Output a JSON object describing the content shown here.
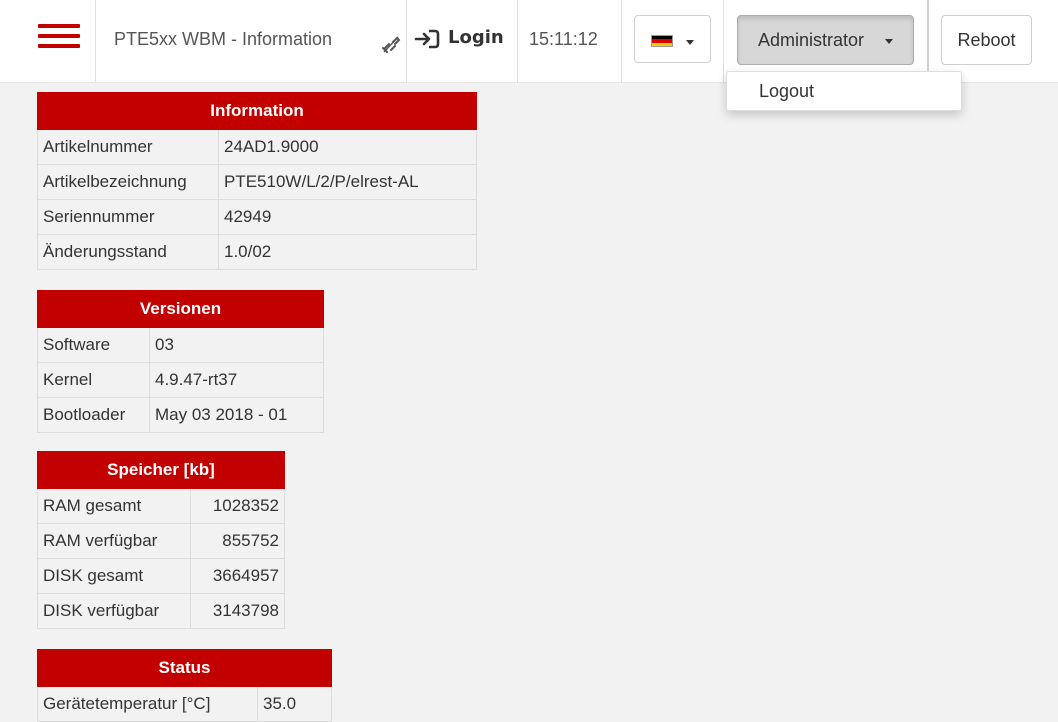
{
  "header": {
    "brand": "PTE5xx WBM - Information",
    "login_label": "Login",
    "time": "15:11:12",
    "user_button": "Administrator",
    "reboot_label": "Reboot",
    "dropdown": {
      "logout_label": "Logout"
    },
    "colors": {
      "accent": "#c30000"
    },
    "icons": {
      "menu": "hamburger-icon",
      "link": "unlink-icon",
      "login": "sign-in-icon",
      "language": "flag-de-icon"
    }
  },
  "tables": {
    "information": {
      "title": "Information",
      "rows": [
        {
          "label": "Artikelnummer",
          "value": "24AD1.9000"
        },
        {
          "label": "Artikelbezeichnung",
          "value": "PTE510W/L/2/P/elrest-AL"
        },
        {
          "label": "Seriennummer",
          "value": "42949"
        },
        {
          "label": "Änderungsstand",
          "value": "1.0/02"
        }
      ]
    },
    "versionen": {
      "title": "Versionen",
      "rows": [
        {
          "label": "Software",
          "value": "03"
        },
        {
          "label": "Kernel",
          "value": "4.9.47-rt37"
        },
        {
          "label": "Bootloader",
          "value": "May 03 2018 - 01"
        }
      ]
    },
    "speicher": {
      "title": "Speicher [kb]",
      "rows": [
        {
          "label": "RAM gesamt",
          "value": "1028352"
        },
        {
          "label": "RAM verfügbar",
          "value": "855752"
        },
        {
          "label": "DISK gesamt",
          "value": "3664957"
        },
        {
          "label": "DISK verfügbar",
          "value": "3143798"
        }
      ]
    },
    "status": {
      "title": "Status",
      "rows": [
        {
          "label": "Gerätetemperatur [°C]",
          "value": "35.0"
        }
      ]
    }
  }
}
